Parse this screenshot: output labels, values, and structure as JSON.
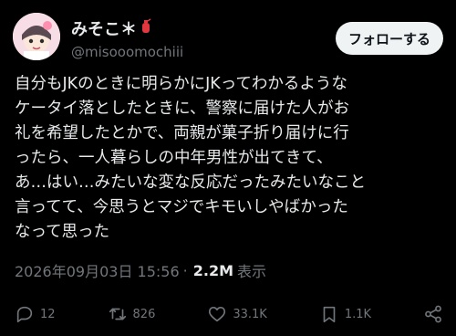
{
  "user": {
    "display_name": "みそこ＊",
    "name_emoji_icon": "red-fire-extinguisher-emoji",
    "handle": "@misooomochiii"
  },
  "follow_label": "フォローする",
  "tweet_text": "自分もJKのときに明らかにJKってわかるような\nケータイ落としたときに、警察に届けた人がお\n礼を希望したとかで、両親が菓子折り届けに行\nったら、一人暮らしの中年男性が出てきて、\nあ…はい…みたいな変な反応だったみたいなこと\n言ってて、今思うとマジでキモいしやばかった\nなって思った",
  "meta": {
    "timestamp": "2026年09月03日 15:56",
    "separator": "·",
    "views_count": "2.2M",
    "views_label": "表示"
  },
  "actions": {
    "replies": "12",
    "retweets": "826",
    "likes": "33.1K",
    "bookmarks": "1.1K"
  },
  "colors": {
    "background": "#000000",
    "text": "#e7e9ea",
    "muted": "#71767b",
    "button_bg": "#eff3f4"
  }
}
